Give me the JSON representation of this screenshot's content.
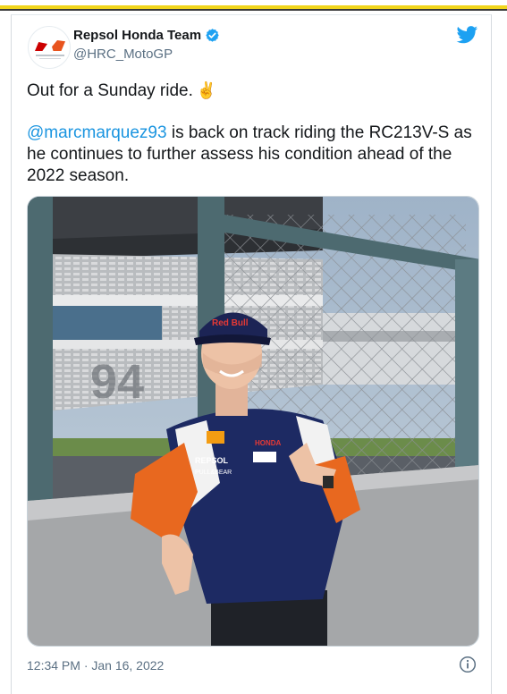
{
  "tweet": {
    "display_name": "Repsol Honda Team",
    "handle": "@HRC_MotoGP",
    "verified": true,
    "line1": "Out for a Sunday ride.",
    "emoji": "✌",
    "mention": "@marcmarquez93",
    "body_rest": " is back on track riding the RC213V-S as he continues to further assess his condition ahead of the 2022 season.",
    "timestamp": "12:34 PM · Jan 16, 2022"
  },
  "photo": {
    "cap_text": "Red Bull",
    "jacket_texts": [
      "HONDA",
      "REPSOL",
      "PULL&BEAR"
    ]
  },
  "colors": {
    "accent": "#1da1f2",
    "link": "#1b95e0",
    "muted": "#5b7083"
  },
  "icons": {
    "logo": "twitter-bird-icon",
    "verified": "verified-badge-icon",
    "info": "info-icon"
  }
}
